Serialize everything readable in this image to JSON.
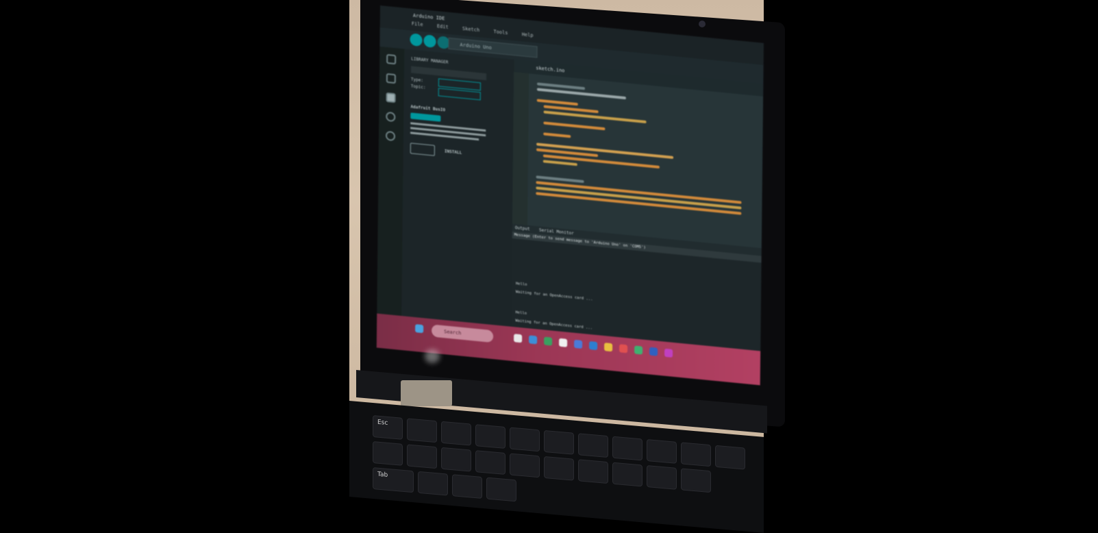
{
  "photo": {
    "description_subject": "laptop",
    "app": {
      "title": "Arduino IDE",
      "menu": [
        "File",
        "Edit",
        "Sketch",
        "Tools",
        "Help"
      ],
      "board_selector": "Arduino Uno",
      "sidebar": {
        "panel_title": "LIBRARY MANAGER",
        "library_name": "Adafruit BusIO",
        "install_label": "INSTALL",
        "filter_labels": [
          "Type:",
          "Topic:"
        ]
      },
      "editor": {
        "tab_label": "sketch.ino"
      },
      "output": {
        "tabs": [
          "Output",
          "Serial Monitor"
        ],
        "message_bar": "Message (Enter to send message to 'Arduino Uno' on 'COM5')",
        "lines": [
          "Hello",
          "Hello",
          "Waiting for an OpenAccess card ...",
          "Waiting for an OpenAccess card ..."
        ]
      }
    },
    "taskbar": {
      "search_label": "Search"
    },
    "keyboard": {
      "labels": [
        "Esc",
        "Tab"
      ]
    }
  },
  "colors": {
    "accent": "#00979d",
    "taskbar": "#9a3654",
    "editor_bg": "#273538"
  }
}
